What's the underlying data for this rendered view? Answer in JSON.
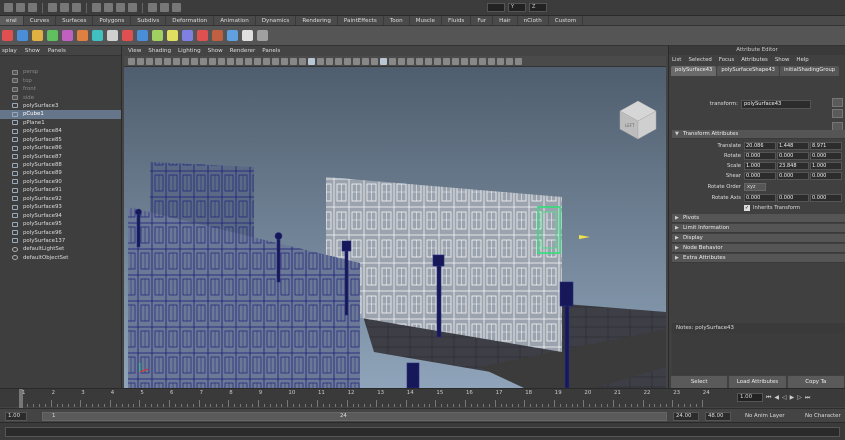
{
  "topbar": {
    "field_x": "",
    "field_y": "Y",
    "field_z": "Z"
  },
  "shelf_tabs": [
    {
      "label": "eral",
      "active": true
    },
    {
      "label": "Curves"
    },
    {
      "label": "Surfaces"
    },
    {
      "label": "Polygons"
    },
    {
      "label": "Subdivs"
    },
    {
      "label": "Deformation"
    },
    {
      "label": "Animation"
    },
    {
      "label": "Dynamics"
    },
    {
      "label": "Rendering"
    },
    {
      "label": "PaintEffects"
    },
    {
      "label": "Toon"
    },
    {
      "label": "Muscle"
    },
    {
      "label": "Fluids"
    },
    {
      "label": "Fur"
    },
    {
      "label": "Hair"
    },
    {
      "label": "nCloth"
    },
    {
      "label": "Custom"
    }
  ],
  "outliner": {
    "menu": [
      "splay",
      "Show",
      "Panels"
    ],
    "items": [
      {
        "label": "persp",
        "type": "camera"
      },
      {
        "label": "top",
        "type": "camera"
      },
      {
        "label": "front",
        "type": "camera"
      },
      {
        "label": "side",
        "type": "camera"
      },
      {
        "label": "polySurface3",
        "type": "mesh"
      },
      {
        "label": "pCube1",
        "type": "mesh",
        "selected": true
      },
      {
        "label": "pPlane1",
        "type": "mesh"
      },
      {
        "label": "polySurface84",
        "type": "mesh"
      },
      {
        "label": "polySurface85",
        "type": "mesh"
      },
      {
        "label": "polySurface86",
        "type": "mesh"
      },
      {
        "label": "polySurface87",
        "type": "mesh"
      },
      {
        "label": "polySurface88",
        "type": "mesh"
      },
      {
        "label": "polySurface89",
        "type": "mesh"
      },
      {
        "label": "polySurface90",
        "type": "mesh"
      },
      {
        "label": "polySurface91",
        "type": "mesh"
      },
      {
        "label": "polySurface92",
        "type": "mesh"
      },
      {
        "label": "polySurface93",
        "type": "mesh"
      },
      {
        "label": "polySurface94",
        "type": "mesh"
      },
      {
        "label": "polySurface95",
        "type": "mesh"
      },
      {
        "label": "polySurface96",
        "type": "mesh"
      },
      {
        "label": "polySurface137",
        "type": "mesh"
      },
      {
        "label": "defaultLightSet",
        "type": "set"
      },
      {
        "label": "defaultObjectSet",
        "type": "set"
      }
    ]
  },
  "viewport": {
    "menu": [
      "View",
      "Shading",
      "Lighting",
      "Show",
      "Renderer",
      "Panels"
    ],
    "cube_label": "LEFT",
    "colors": {
      "sky_top": "#4f5e6e",
      "sky_bottom": "#8fa4ba",
      "wire_blue": "#1c1f7a",
      "wire_white": "#f0f0f0",
      "selected": "#2fe07a"
    }
  },
  "attribute_editor": {
    "title": "Attribute Editor",
    "menu": [
      "List",
      "Selected",
      "Focus",
      "Attributes",
      "Show",
      "Help"
    ],
    "tabs": [
      "polySurface43",
      "polySurfaceShape43",
      "initialShadingGroup"
    ],
    "transform_label": "transform:",
    "transform_value": "polySurface43",
    "section_transform": "Transform Attributes",
    "translate": {
      "label": "Translate",
      "x": "20.086",
      "y": "1.448",
      "z": "8.971"
    },
    "rotate": {
      "label": "Rotate",
      "x": "0.000",
      "y": "0.000",
      "z": "0.000"
    },
    "scale": {
      "label": "Scale",
      "x": "1.000",
      "y": "23.848",
      "z": "1.000"
    },
    "shear": {
      "label": "Shear",
      "x": "0.000",
      "y": "0.000",
      "z": "0.000"
    },
    "rotate_order": {
      "label": "Rotate Order",
      "value": "xyz"
    },
    "rotate_axis": {
      "label": "Rotate Axis",
      "x": "0.000",
      "y": "0.000",
      "z": "0.000"
    },
    "inherits": "Inherits Transform",
    "sections": [
      "Pivots",
      "Limit Information",
      "Display",
      "Node Behavior",
      "Extra Attributes"
    ],
    "notes_label": "Notes:",
    "notes_value": "polySurface43",
    "buttons": [
      "Select",
      "Load Attributes",
      "Copy Ta"
    ]
  },
  "timeline": {
    "ticks": [
      "1",
      "2",
      "3",
      "4",
      "5",
      "6",
      "7",
      "8",
      "9",
      "10",
      "11",
      "12",
      "13",
      "14",
      "15",
      "16",
      "17",
      "18",
      "19",
      "20",
      "21",
      "22",
      "23",
      "24"
    ],
    "current_frame": "1.00",
    "start": "1.00",
    "range_start": "1.00",
    "slider_start": "1",
    "slider_end": "24",
    "range_end": "24.00",
    "end": "48.00",
    "anim_layer": "No Anim Layer",
    "character": "No Character"
  }
}
